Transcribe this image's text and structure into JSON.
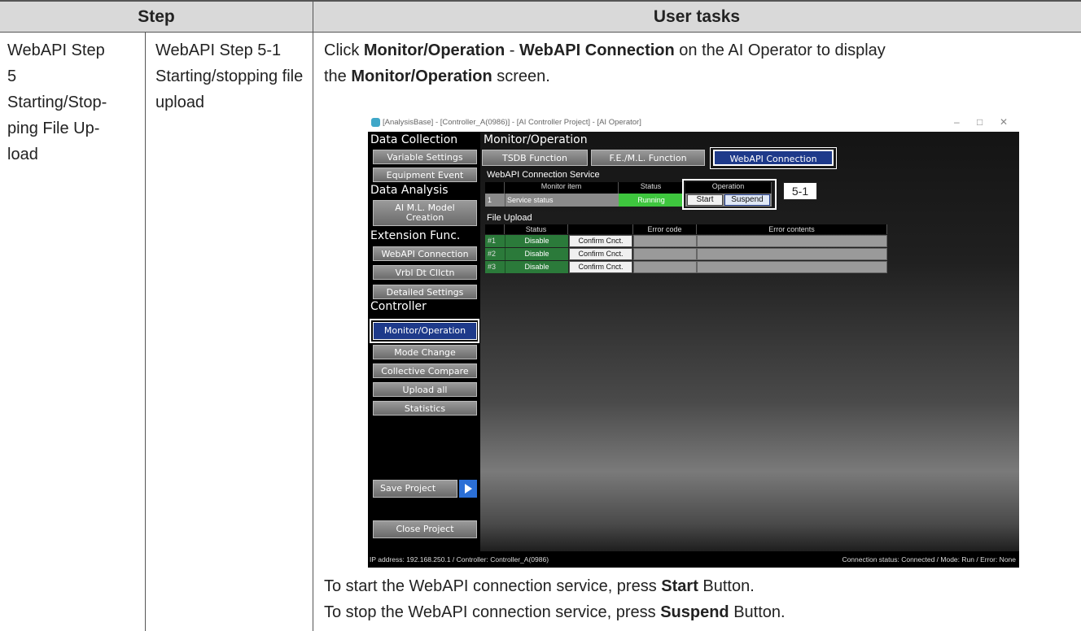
{
  "header": {
    "step": "Step",
    "user_tasks": "User tasks"
  },
  "row": {
    "step_main_lines": [
      "WebAPI Step",
      "5",
      "Starting/Stop-",
      "ping File Up-",
      "load"
    ],
    "step_sub_lines": [
      "WebAPI Step 5-1",
      "Starting/stopping file",
      "upload"
    ],
    "task_intro": {
      "p1": "Click ",
      "b1": "Monitor/Operation",
      "p2": " - ",
      "b2": "WebAPI Connection",
      "p3": " on the AI Operator to display",
      "p4": "the ",
      "b3": "Monitor/Operation",
      "p5": " screen."
    },
    "task_start": {
      "p1": "To start the WebAPI connection service, press ",
      "b1": "Start",
      "p2": " Button."
    },
    "task_stop": {
      "p1": "To stop the WebAPI connection service, press ",
      "b1": "Suspend",
      "p2": " Button."
    }
  },
  "screenshot": {
    "window_title": "[AnalysisBase] - [Controller_A(0986)] - [AI Controller Project] - [AI Operator]",
    "window_controls": [
      "–",
      "□",
      "✕"
    ],
    "sidebar": {
      "heading_data_collection": "Data Collection",
      "variable_settings": "Variable Settings",
      "equipment_event": "Equipment Event",
      "heading_data_analysis": "Data Analysis",
      "ai_ml_model_creation_1": "AI M.L. Model",
      "ai_ml_model_creation_2": "Creation",
      "heading_extension": "Extension Func.",
      "webapi_connection": "WebAPI Connection",
      "vrbl_dt_cllctn": "Vrbl Dt Cllctn",
      "detailed_settings": "Detailed Settings",
      "heading_controller": "Controller",
      "monitor_operation": "Monitor/Operation",
      "mode_change": "Mode Change",
      "collective_compare": "Collective Compare",
      "upload_all": "Upload all",
      "statistics": "Statistics",
      "save_project": "Save Project",
      "close_project": "Close Project"
    },
    "main": {
      "title": "Monitor/Operation",
      "tabs": [
        "TSDB Function",
        "F.E./M.L. Function",
        "WebAPI Connection"
      ],
      "service_section": "WebAPI Connection Service",
      "service_headers": [
        "Monitor item",
        "Status",
        "Operation"
      ],
      "service_row": {
        "index": "1",
        "item": "Service status",
        "status": "Running",
        "start": "Start",
        "suspend": "Suspend"
      },
      "callout": "5-1",
      "upload_section": "File Upload",
      "upload_headers": [
        "Status",
        "",
        "Error code",
        "Error contents"
      ],
      "upload_rows": [
        {
          "index": "#1",
          "status": "Disable",
          "button": "Confirm Cnct."
        },
        {
          "index": "#2",
          "status": "Disable",
          "button": "Confirm Cnct."
        },
        {
          "index": "#3",
          "status": "Disable",
          "button": "Confirm Cnct."
        }
      ]
    },
    "statusbar": {
      "left": "IP address: 192.168.250.1 / Controller: Controller_A(0986)",
      "right": "Connection status: Connected / Mode: Run / Error: None"
    },
    "colors": {
      "selected_blue": "#1e3a8a",
      "running_green": "#3ec63e",
      "disable_green": "#2b7a3a"
    }
  }
}
